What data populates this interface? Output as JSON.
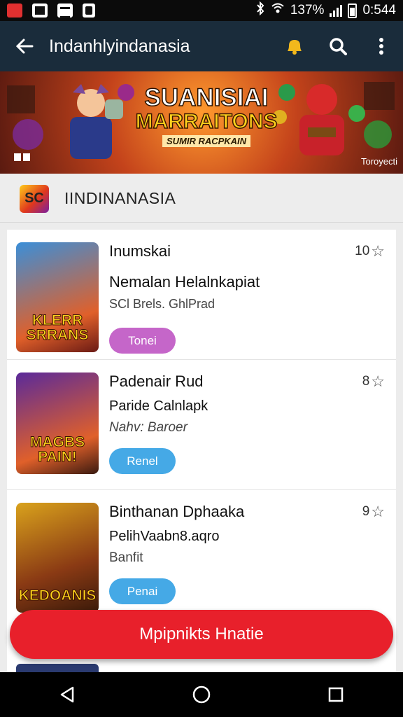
{
  "status_bar": {
    "percent": "137%",
    "time": "0:544"
  },
  "app_bar": {
    "title": "Indanhlyindanasia"
  },
  "banner": {
    "line1": "SUANISIAI",
    "line2": "MARRAITONS",
    "line3": "SUMIR RACPKAIN",
    "watermark": "Toroyecti"
  },
  "section": {
    "logo_text": "SC",
    "title": "IINDINANASIA"
  },
  "items": [
    {
      "name": "Inumskai",
      "subtitle": "Nemalan Helalnkapiat",
      "meta": "SCl Brels. GhlPrad",
      "rating": "10",
      "button": "Tonei",
      "button_color": "#c566c9",
      "thumb_title": "KLERR SRRANS",
      "thumb_colors": [
        "#3a8fd9",
        "#e0602a"
      ]
    },
    {
      "name": "Padenair Rud",
      "subtitle": "Paride Calnlapk",
      "meta": "Nahv: Baroer",
      "rating": "8",
      "button": "Renel",
      "button_color": "#45a9e6",
      "thumb_title": "MAGBS PAIN!",
      "thumb_colors": [
        "#5a2a9a",
        "#e0602a"
      ]
    },
    {
      "name": "Binthanan Dphaaka",
      "subtitle": "PelihVaabn8.aqro",
      "meta": "Banfit",
      "rating": "9",
      "button": "Penai",
      "button_color": "#45a9e6",
      "thumb_title": "KEDOANIS",
      "thumb_colors": [
        "#d9a21c",
        "#5a2a14"
      ]
    }
  ],
  "cta": {
    "label": "Mpipnikts Hnatie"
  }
}
